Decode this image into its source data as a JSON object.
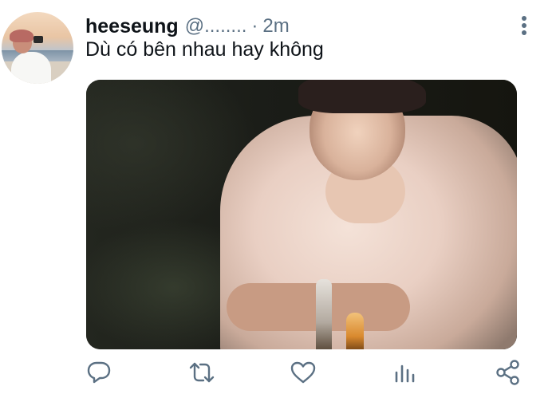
{
  "tweet": {
    "display_name": "heeseung",
    "handle": "@........",
    "separator": "·",
    "time": "2m",
    "text": "Dù có bên nhau hay không"
  },
  "icons": {
    "more": "more-vertical-icon",
    "reply": "reply-icon",
    "retweet": "retweet-icon",
    "like": "heart-icon",
    "analytics": "analytics-icon",
    "share": "share-icon"
  },
  "colors": {
    "text": "#0f1419",
    "secondary": "#5b7083"
  }
}
